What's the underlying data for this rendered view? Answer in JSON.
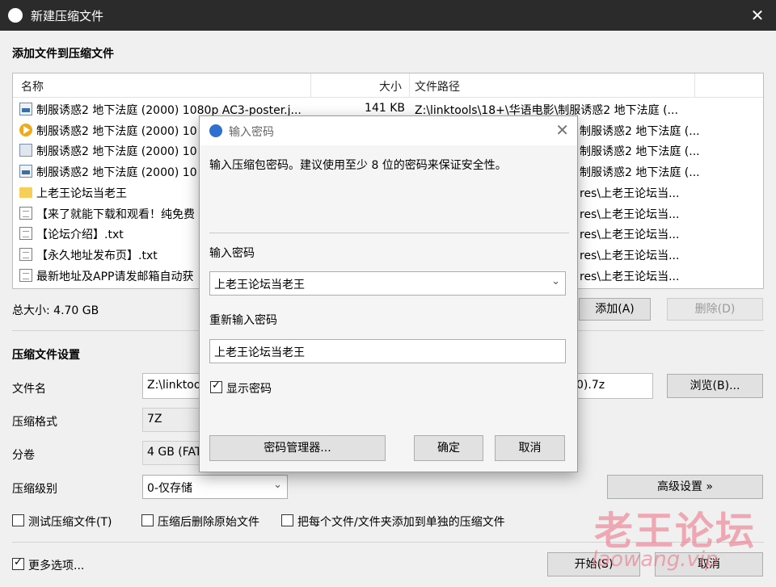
{
  "window": {
    "title": "新建压缩文件"
  },
  "section_add": "添加文件到压缩文件",
  "file_list": {
    "headers": {
      "name": "名称",
      "size": "大小",
      "path": "文件路径"
    },
    "rows": [
      {
        "icon": "image-file-icon",
        "name": "制服诱惑2 地下法庭 (2000) 1080p AC3-poster.j...",
        "size": "141 KB",
        "path": "Z:\\linktools\\18+\\华语电影\\制服诱惑2 地下法庭 (..."
      },
      {
        "icon": "video-file-icon",
        "name": "制服诱惑2 地下法庭 (2000) 10",
        "size": "",
        "path": "制服诱惑2 地下法庭 (..."
      },
      {
        "icon": "nfo-file-icon",
        "name": "制服诱惑2 地下法庭 (2000) 10",
        "size": "",
        "path": "制服诱惑2 地下法庭 (..."
      },
      {
        "icon": "image-file-icon",
        "name": "制服诱惑2 地下法庭 (2000) 10",
        "size": "",
        "path": "制服诱惑2 地下法庭 (..."
      },
      {
        "icon": "folder-icon",
        "name": "上老王论坛当老王",
        "size": "",
        "path": "res\\上老王论坛当..."
      },
      {
        "icon": "text-file-icon",
        "name": "【来了就能下载和观看！纯免费",
        "size": "",
        "path": "res\\上老王论坛当..."
      },
      {
        "icon": "text-file-icon",
        "name": "【论坛介绍】.txt",
        "size": "",
        "path": "res\\上老王论坛当..."
      },
      {
        "icon": "text-file-icon",
        "name": "【永久地址发布页】.txt",
        "size": "",
        "path": "res\\上老王论坛当..."
      },
      {
        "icon": "text-file-icon",
        "name": "最新地址及APP请发邮箱自动获",
        "size": "",
        "path": "res\\上老王论坛当..."
      }
    ]
  },
  "total_size": "总大小: 4.70 GB",
  "buttons": {
    "add": "添加(A)",
    "delete": "删除(D)",
    "browse": "浏览(B)...",
    "advanced": "高级设置 »",
    "start": "开始(S)",
    "cancel": "取消"
  },
  "section_settings": "压缩文件设置",
  "settings": {
    "filename_label": "文件名",
    "filename_value": "Z:\\linktoo",
    "filename_tail": "0).7z",
    "format_label": "压缩格式",
    "format_value": "7Z",
    "split_label": "分卷",
    "split_value": "4 GB (FAT",
    "level_label": "压缩级别",
    "level_value": "0-仅存储"
  },
  "options": {
    "test": {
      "label": "测试压缩文件(T)",
      "checked": false
    },
    "delete_after": {
      "label": "压缩后删除原始文件",
      "checked": false
    },
    "separate": {
      "label": "把每个文件/文件夹添加到单独的压缩文件",
      "checked": false
    },
    "more": {
      "label": "更多选项...",
      "checked": true
    }
  },
  "dialog": {
    "title": "输入密码",
    "hint": "输入压缩包密码。建议使用至少 8 位的密码来保证安全性。",
    "password_label": "输入密码",
    "password_value": "上老王论坛当老王",
    "confirm_label": "重新输入密码",
    "confirm_value": "上老王论坛当老王",
    "show_password": {
      "label": "显示密码",
      "checked": true
    },
    "manager_button": "密码管理器...",
    "ok_button": "确定",
    "cancel_button": "取消"
  },
  "watermark": {
    "main": "老王论坛",
    "sub": "laowang.vip"
  }
}
